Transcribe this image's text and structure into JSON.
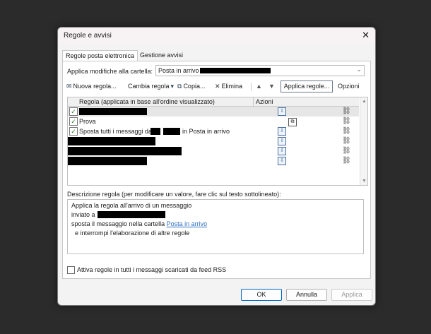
{
  "window": {
    "title": "Regole e avvisi",
    "close_glyph": "✕"
  },
  "tabs": [
    {
      "label": "Regole posta elettronica",
      "active": true
    },
    {
      "label": "Gestione avvisi",
      "active": false
    }
  ],
  "apply_to": {
    "label": "Applica modifiche alla cartella:",
    "value": "Posta in arrivo",
    "arrow": "⌄"
  },
  "toolbar": {
    "new_rule": "Nuova regola...",
    "change_rule": "Cambia regola",
    "copy": "Copia...",
    "delete": "Elimina",
    "up": "▲",
    "down": "▼",
    "apply_rules": "Applica regole...",
    "options": "Opzioni"
  },
  "list": {
    "col_rule": "Regola (applicata in base all'ordine visualizzato)",
    "col_actions": "Azioni",
    "rows": [
      {
        "checked": true,
        "text": ""
      },
      {
        "checked": true,
        "text": "Prova"
      },
      {
        "checked": true,
        "text_prefix": "Sposta tutti i messaggi da",
        "text_suffix": "in Posta in arrivo"
      },
      {
        "checked": false,
        "text": ""
      },
      {
        "checked": false,
        "text": ""
      },
      {
        "checked": false,
        "text": ""
      }
    ]
  },
  "description": {
    "label": "Descrizione regola (per modificare un valore, fare clic sul testo sottolineato):",
    "line1": "Applica la regola all'arrivo di un messaggio",
    "line2_prefix": "inviato a",
    "line3_prefix": "sposta il messaggio nella cartella",
    "line3_link": "Posta in arrivo",
    "line4": "e interrompi l'elaborazione di altre regole"
  },
  "rss": {
    "label": "Attiva regole in tutti i messaggi scaricati da feed RSS",
    "checked": false
  },
  "buttons": {
    "ok": "OK",
    "cancel": "Annulla",
    "apply": "Applica"
  },
  "colors": {
    "link": "#2a6fc4",
    "check": "#2a7d2a",
    "accent": "#0067c0"
  }
}
